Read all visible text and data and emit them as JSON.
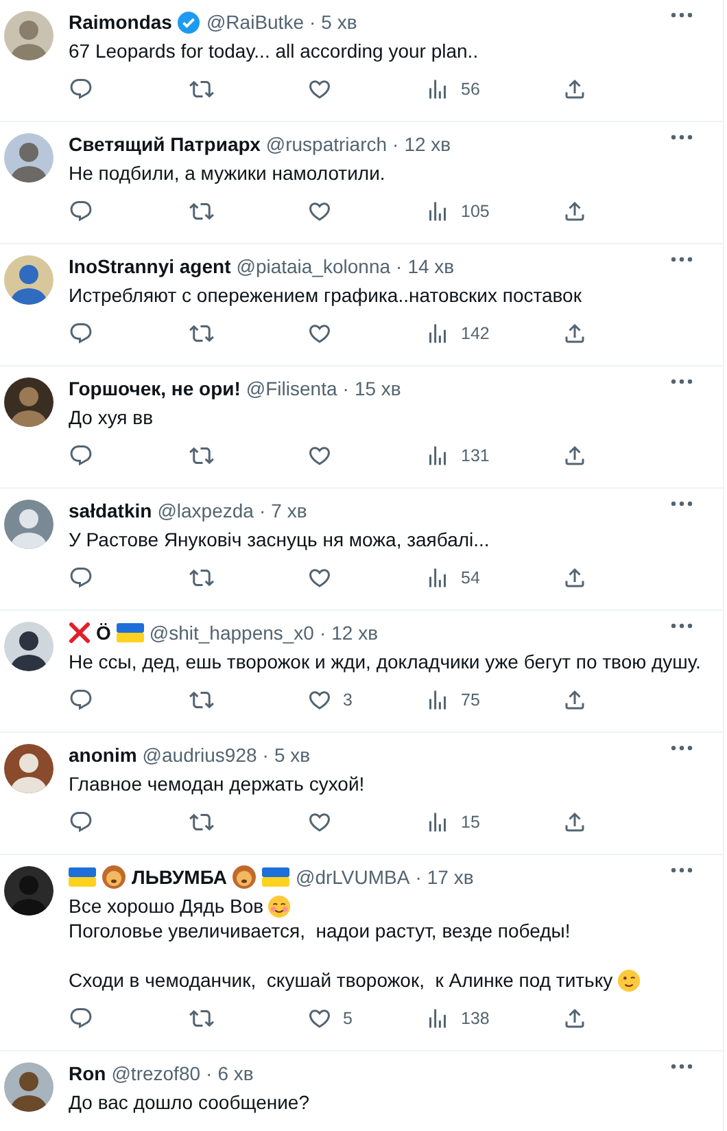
{
  "tweets": [
    {
      "name": [
        {
          "kind": "text",
          "text": "Raimondas"
        }
      ],
      "verified": true,
      "handle": "@RaiButke",
      "dot": "·",
      "time": "5 хв",
      "paragraphs": [
        [
          [
            {
              "kind": "text",
              "text": "67 Leopards for today... all according your plan.."
            }
          ]
        ]
      ],
      "actions": {
        "views": "56"
      }
    },
    {
      "name": [
        {
          "kind": "text",
          "text": "Светящий Патриарх"
        }
      ],
      "verified": false,
      "handle": "@ruspatriarch",
      "dot": "·",
      "time": "12 хв",
      "paragraphs": [
        [
          [
            {
              "kind": "text",
              "text": "Не подбили, а мужики намолотили."
            }
          ]
        ]
      ],
      "actions": {
        "views": "105"
      }
    },
    {
      "name": [
        {
          "kind": "text",
          "text": "InoStrannyi agent"
        }
      ],
      "verified": false,
      "handle": "@piataia_kolonna",
      "dot": "·",
      "time": "14 хв",
      "paragraphs": [
        [
          [
            {
              "kind": "text",
              "text": "Истребляют с опережением графика..натовских поставок"
            }
          ]
        ]
      ],
      "actions": {
        "views": "142"
      }
    },
    {
      "name": [
        {
          "kind": "text",
          "text": "Горшочек, не ори!"
        }
      ],
      "verified": false,
      "handle": "@Filisenta",
      "dot": "·",
      "time": "15 хв",
      "paragraphs": [
        [
          [
            {
              "kind": "text",
              "text": "До хуя вв"
            }
          ]
        ]
      ],
      "actions": {
        "views": "131"
      }
    },
    {
      "name": [
        {
          "kind": "text",
          "text": "sałdatkin"
        }
      ],
      "verified": false,
      "handle": "@laxpezda",
      "dot": "·",
      "time": "7 хв",
      "paragraphs": [
        [
          [
            {
              "kind": "text",
              "text": "У Растове Януковіч заснуць ня можа, заябалі..."
            }
          ]
        ]
      ],
      "actions": {
        "views": "54"
      }
    },
    {
      "name": [
        {
          "kind": "cross"
        },
        {
          "kind": "text",
          "text": "Ö"
        },
        {
          "kind": "flag"
        }
      ],
      "verified": false,
      "handle": "@shit_happens_x0",
      "dot": "·",
      "time": "12 хв",
      "paragraphs": [
        [
          [
            {
              "kind": "text",
              "text": "Не ссы, дед, ешь творожок и жди, докладчики уже бегут по твою душу."
            }
          ]
        ]
      ],
      "actions": {
        "likes": "3",
        "views": "75"
      }
    },
    {
      "name": [
        {
          "kind": "text",
          "text": "anonim"
        }
      ],
      "verified": false,
      "handle": "@audrius928",
      "dot": "·",
      "time": "5 хв",
      "paragraphs": [
        [
          [
            {
              "kind": "text",
              "text": "Главное чемодан держать сухой!"
            }
          ]
        ]
      ],
      "actions": {
        "views": "15"
      }
    },
    {
      "name": [
        {
          "kind": "flag"
        },
        {
          "kind": "lion"
        },
        {
          "kind": "text",
          "text": "ЛЬВУМБА"
        },
        {
          "kind": "lion"
        },
        {
          "kind": "flag"
        }
      ],
      "verified": false,
      "handle": "@drLVUMBA",
      "dot": "·",
      "time": "17 хв",
      "paragraphs": [
        [
          [
            {
              "kind": "text",
              "text": "Все хорошо Дядь Вов"
            },
            {
              "kind": "smile"
            }
          ],
          [
            {
              "kind": "text",
              "text": "Поголовье увеличивается,  надои растут, везде победы!"
            }
          ]
        ],
        [
          [
            {
              "kind": "text",
              "text": "Сходи в чемоданчик,  скушай творожок,  к Алинке под титьку"
            },
            {
              "kind": "wink"
            }
          ]
        ]
      ],
      "actions": {
        "likes": "5",
        "views": "138"
      }
    },
    {
      "name": [
        {
          "kind": "text",
          "text": "Ron"
        }
      ],
      "verified": false,
      "handle": "@trezof80",
      "dot": "·",
      "time": "6 хв",
      "paragraphs": [
        [
          [
            {
              "kind": "text",
              "text": "До вас дошло сообщение?"
            }
          ]
        ]
      ]
    }
  ]
}
